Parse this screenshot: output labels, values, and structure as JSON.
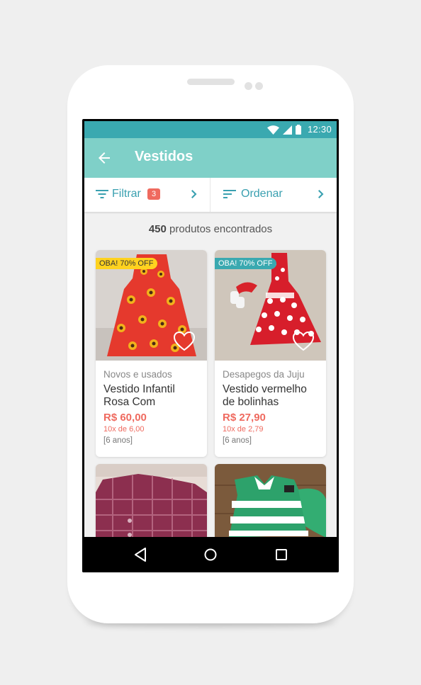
{
  "status_bar": {
    "time": "12:30"
  },
  "app_bar": {
    "title": "Vestidos"
  },
  "toolbar": {
    "filter_label": "Filtrar",
    "filter_count": "3",
    "sort_label": "Ordenar"
  },
  "results": {
    "count": "450",
    "suffix": "produtos encontrados"
  },
  "products": [
    {
      "promo": "OBA! 70% OFF",
      "seller": "Novos e usados",
      "title": "Vestido Infantil Rosa Com",
      "price": "R$ 60,00",
      "installments": "10x de 6,00",
      "size": "[6 anos]"
    },
    {
      "promo": "OBA! 70% OFF",
      "seller": "Desapegos da Juju",
      "title": "Vestido vermelho de bolinhas",
      "price": "R$ 27,90",
      "installments": "10x de 2,79",
      "size": "[6 anos]"
    },
    {
      "promo": "",
      "seller": "",
      "title": "",
      "price": "",
      "installments": "",
      "size": ""
    },
    {
      "promo": "",
      "seller": "",
      "title": "",
      "price": "",
      "installments": "",
      "size": ""
    }
  ],
  "colors": {
    "status_bar": "#3aa9b0",
    "app_bar": "#7fd0c8",
    "accent": "#3aa0b0",
    "price": "#ef6a5f",
    "promo_yellow": "#ffd21f",
    "promo_teal": "#3aa9b0"
  },
  "icons": {
    "status": [
      "wifi-icon",
      "signal-icon",
      "battery-icon"
    ],
    "app_bar": "arrow-back-icon",
    "filter": "filter-icon",
    "sort": "sort-icon",
    "favorite": "heart-icon",
    "nav": [
      "nav-back-icon",
      "nav-home-icon",
      "nav-recents-icon"
    ]
  }
}
